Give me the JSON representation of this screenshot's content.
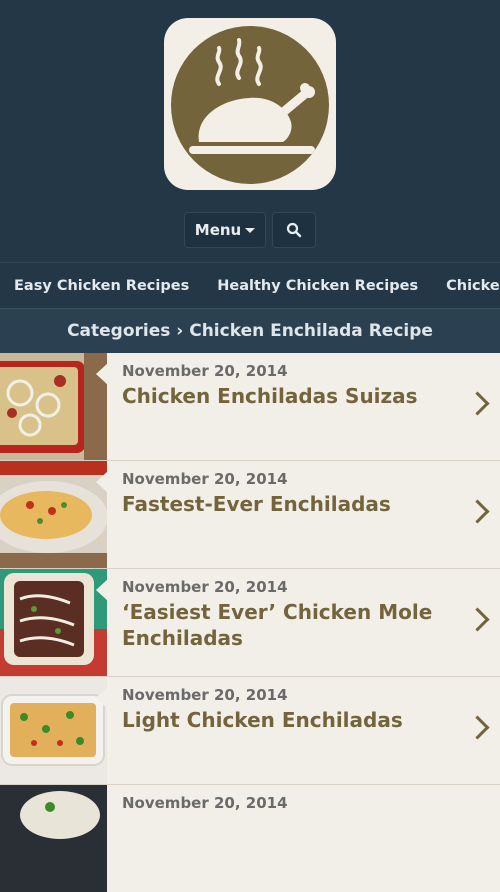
{
  "header": {
    "logo_icon": "roast-chicken-icon",
    "menu_label": "Menu",
    "search_icon": "search-icon"
  },
  "topnav": {
    "links": [
      "Easy Chicken Recipes",
      "Healthy Chicken Recipes",
      "Chicken Parmesan"
    ]
  },
  "breadcrumb": {
    "text": "Categories › Chicken Enchilada Recipe"
  },
  "posts": [
    {
      "date": "November 20, 2014",
      "title": "Chicken Enchiladas Suizas"
    },
    {
      "date": "November 20, 2014",
      "title": "Fastest-Ever Enchiladas"
    },
    {
      "date": "November 20, 2014",
      "title": "‘Easiest Ever’ Chicken Mole Enchiladas"
    },
    {
      "date": "November 20, 2014",
      "title": "Light Chicken Enchiladas"
    },
    {
      "date": "November 20, 2014",
      "title": ""
    }
  ],
  "colors": {
    "brand": "#74643c",
    "header_bg": "#233746",
    "list_bg": "#f2efe9"
  }
}
